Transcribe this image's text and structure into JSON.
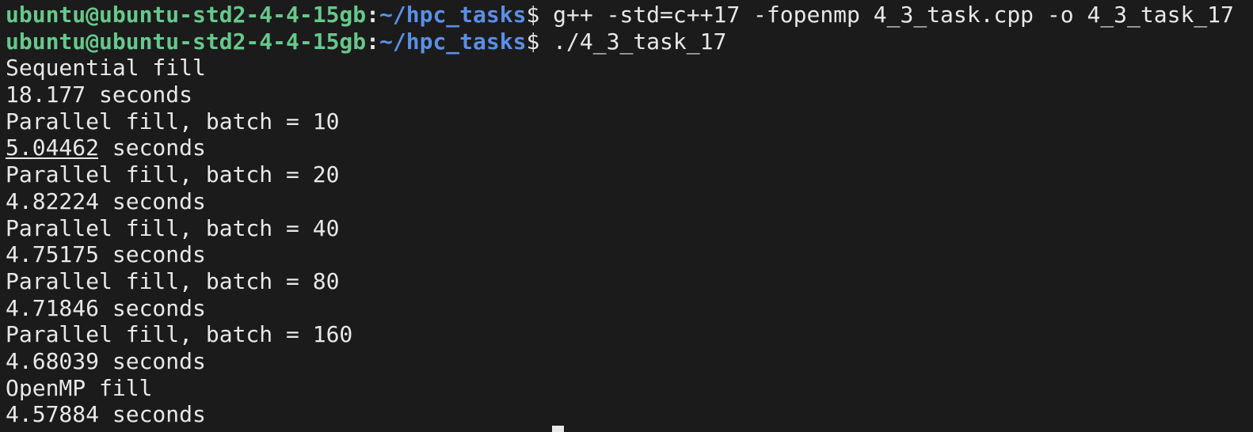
{
  "terminal": {
    "prompt": {
      "user_host": "ubuntu@ubuntu-std2-4-4-15gb",
      "colon": ":",
      "path": "~/hpc_tasks",
      "dollar": "$ "
    },
    "commands": [
      "g++ -std=c++17 -fopenmp 4_3_task.cpp -o 4_3_task_17",
      "./4_3_task_17"
    ],
    "output": [
      "Sequential fill",
      "18.177 seconds",
      "Parallel fill, batch = 10",
      "5.04462 seconds",
      "Parallel fill, batch = 20",
      "4.82224 seconds",
      "Parallel fill, batch = 40",
      "4.75175 seconds",
      "Parallel fill, batch = 80",
      "4.71846 seconds",
      "Parallel fill, batch = 160",
      "4.68039 seconds",
      "OpenMP fill",
      "4.57884 seconds"
    ],
    "colors": {
      "background": "#1b1b1b",
      "text": "#e8e8e8",
      "user_host": "#66c88b",
      "path": "#5a8fe6"
    }
  }
}
